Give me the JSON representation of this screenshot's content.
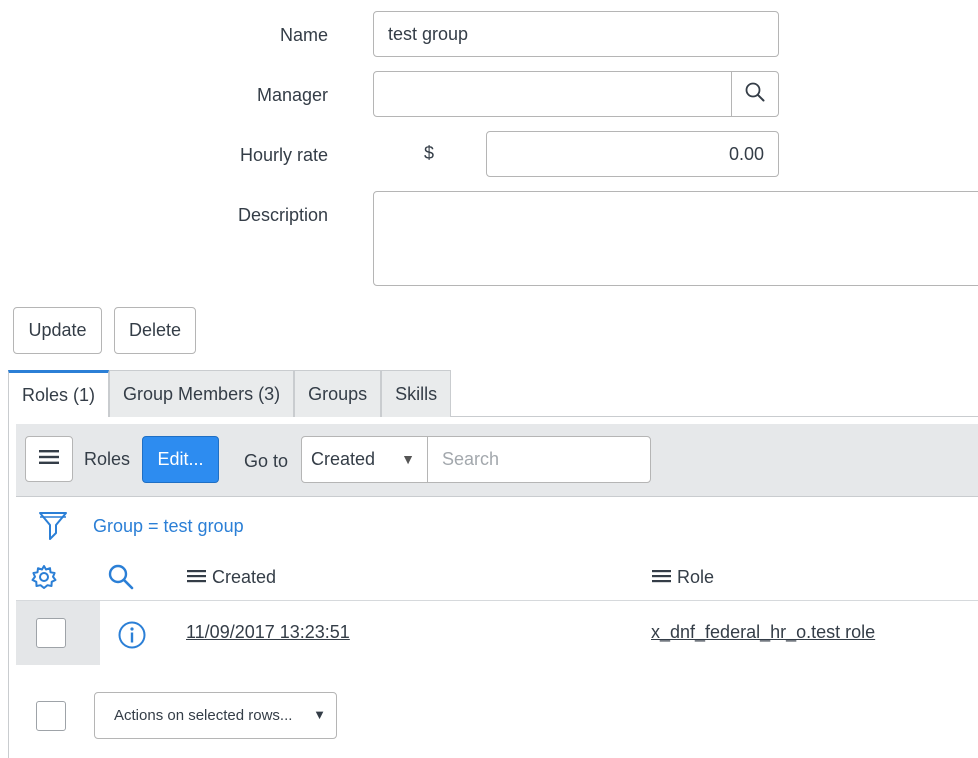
{
  "form": {
    "name": {
      "label": "Name",
      "value": "test group"
    },
    "manager": {
      "label": "Manager",
      "value": "",
      "lookup_icon": "search-icon"
    },
    "hourly_rate": {
      "label": "Hourly rate",
      "currency": "$",
      "value": "0.00"
    },
    "description": {
      "label": "Description",
      "value": ""
    }
  },
  "buttons": {
    "update": "Update",
    "delete": "Delete"
  },
  "tabs": [
    {
      "label": "Roles (1)",
      "active": true
    },
    {
      "label": "Group Members (3)",
      "active": false
    },
    {
      "label": "Groups",
      "active": false
    },
    {
      "label": "Skills",
      "active": false
    }
  ],
  "list": {
    "title": "Roles",
    "edit_label": "Edit...",
    "goto_label": "Go to",
    "goto_field": "Created",
    "search_placeholder": "Search",
    "filter_text": "Group = test group",
    "columns": [
      "Created",
      "Role"
    ],
    "rows": [
      {
        "created": "11/09/2017 13:23:51",
        "role": "x_dnf_federal_hr_o.test role"
      }
    ],
    "actions_label": "Actions on selected rows..."
  },
  "colors": {
    "accent": "#2b7fd6",
    "edit_button": "#2d8cf0",
    "toolbar_bg": "#e6e8ea"
  }
}
